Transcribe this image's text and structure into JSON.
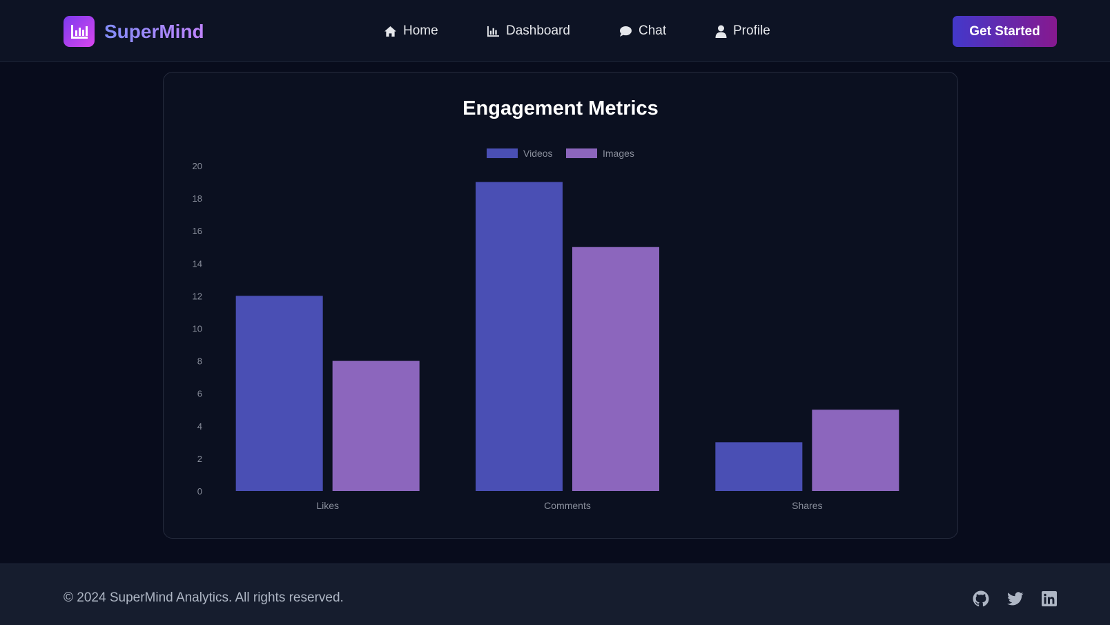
{
  "brand": {
    "name": "SuperMind",
    "icon": "bar-chart-icon"
  },
  "nav": [
    {
      "label": "Home",
      "icon": "home-icon"
    },
    {
      "label": "Dashboard",
      "icon": "chart-icon"
    },
    {
      "label": "Chat",
      "icon": "chat-bubble-icon"
    },
    {
      "label": "Profile",
      "icon": "user-icon"
    }
  ],
  "cta_label": "Get Started",
  "chart_data": {
    "type": "bar",
    "title": "Engagement Metrics",
    "categories": [
      "Likes",
      "Comments",
      "Shares"
    ],
    "series": [
      {
        "name": "Videos",
        "values": [
          12,
          19,
          3
        ],
        "color": "#4a4fb4"
      },
      {
        "name": "Images",
        "values": [
          8,
          15,
          5
        ],
        "color": "#8c66bd"
      }
    ],
    "ylim": [
      0,
      20
    ],
    "yticks": [
      0,
      2,
      4,
      6,
      8,
      10,
      12,
      14,
      16,
      18,
      20
    ],
    "xlabel": "",
    "ylabel": "",
    "grid": false,
    "legend_position": "top-center"
  },
  "footer": {
    "copyright": "© 2024 SuperMind Analytics. All rights reserved.",
    "social": [
      "github-icon",
      "twitter-icon",
      "linkedin-icon"
    ]
  }
}
